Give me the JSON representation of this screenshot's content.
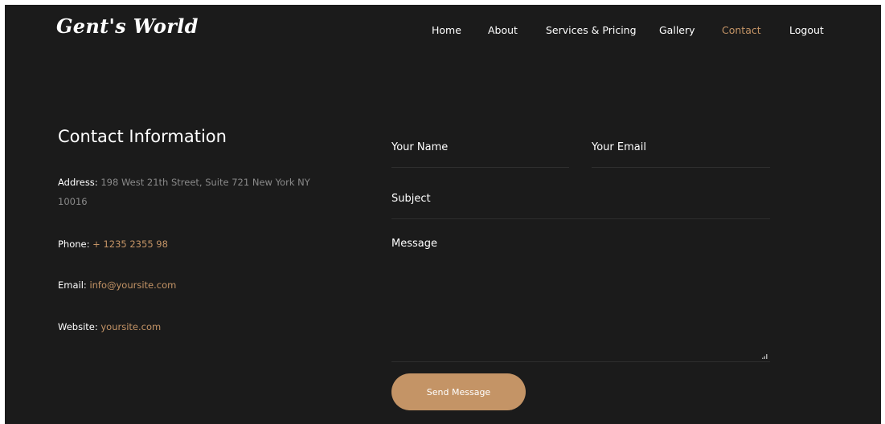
{
  "brand": {
    "name": "Gent's World"
  },
  "nav": {
    "items": [
      {
        "label": "Home"
      },
      {
        "label": "About"
      },
      {
        "label": "Services & Pricing"
      },
      {
        "label": "Gallery"
      },
      {
        "label": "Contact",
        "active": true
      },
      {
        "label": "Logout"
      }
    ]
  },
  "contact": {
    "title": "Contact Information",
    "address": {
      "label": "Address:",
      "value": "198 West 21th Street, Suite 721 New York NY 10016"
    },
    "phone": {
      "label": "Phone:",
      "value": "+ 1235 2355 98"
    },
    "email": {
      "label": "Email:",
      "value": "info@yoursite.com"
    },
    "website": {
      "label": "Website:",
      "value": "yoursite.com"
    }
  },
  "form": {
    "name_label": "Your Name",
    "email_label": "Your Email",
    "subject_label": "Subject",
    "message_label": "Message",
    "submit_label": "Send Message"
  },
  "colors": {
    "background": "#1b1b1b",
    "accent": "#c49466",
    "text": "#ffffff",
    "muted": "#8a8a8a",
    "divider": "#2e2e2e"
  }
}
